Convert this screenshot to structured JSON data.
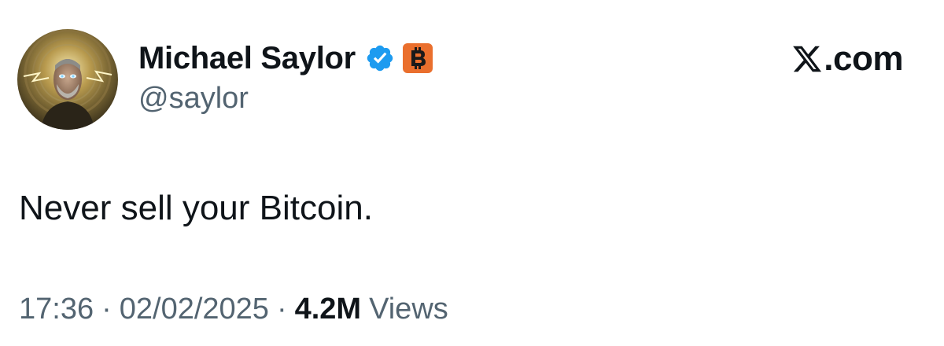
{
  "tweet": {
    "author": {
      "display_name": "Michael Saylor",
      "handle": "@saylor",
      "verified_icon": "verified-badge-icon",
      "affiliate_icon": "bitcoin-icon",
      "avatar": "profile-photo"
    },
    "brand": {
      "logo_icon": "x-logo-icon",
      "suffix": ".com"
    },
    "text": "Never sell your Bitcoin.",
    "meta": {
      "time": "17:36",
      "separator": "·",
      "date": "02/02/2025",
      "views_count": "4.2M",
      "views_label": "Views"
    },
    "colors": {
      "verified_blue": "#1d9bf0",
      "bitcoin_orange": "#ea6f2d",
      "text_primary": "#0f1419",
      "text_secondary": "#536471"
    }
  }
}
